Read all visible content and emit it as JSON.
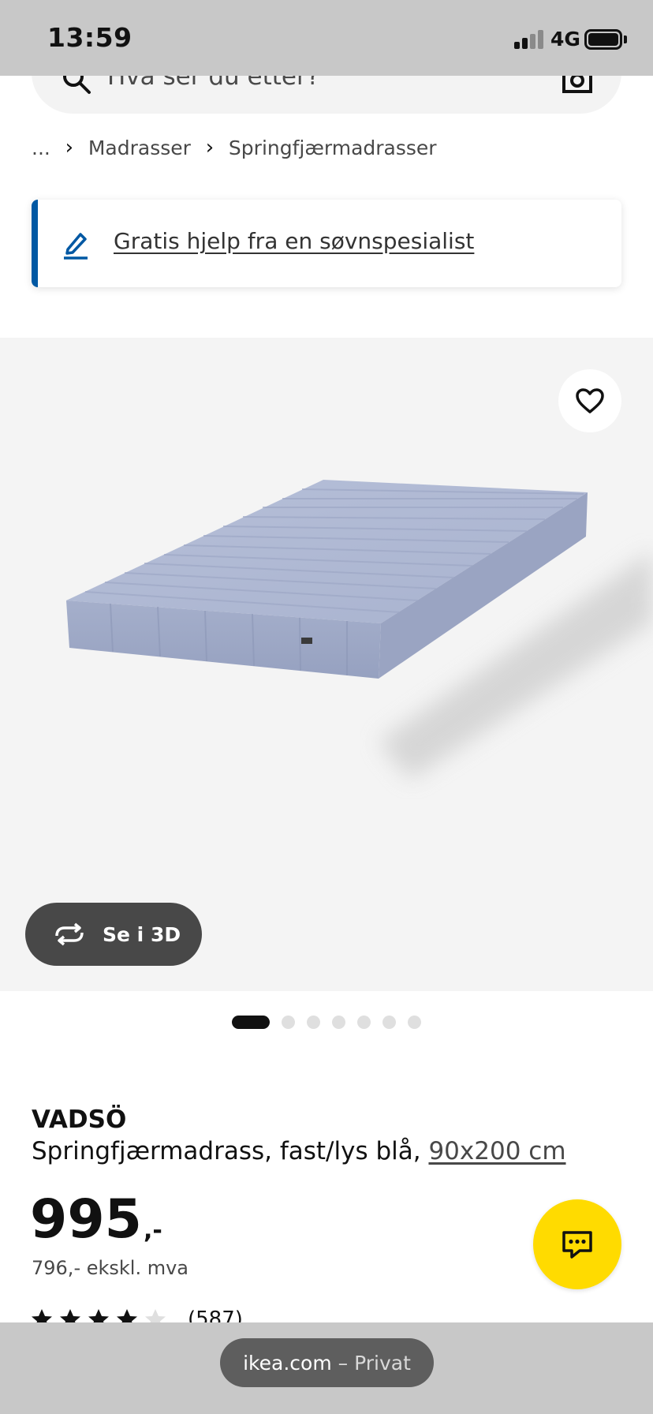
{
  "status_bar": {
    "time": "13:59",
    "network": "4G"
  },
  "search": {
    "placeholder": "Hva ser du etter?"
  },
  "breadcrumb": {
    "ellipsis": "...",
    "items": [
      "Madrasser",
      "Springfjærmadrasser"
    ]
  },
  "help_banner": {
    "text": "Gratis hjelp fra en søvnspesialist",
    "accent_color": "#0058a3"
  },
  "product_image": {
    "view_3d_label": "Se i 3D",
    "carousel": {
      "total": 7,
      "active": 1
    }
  },
  "product": {
    "name": "VADSÖ",
    "description": "Springfjærmadrass, fast/lys blå, ",
    "size": "90x200 cm",
    "price": "995",
    "price_suffix": ",-",
    "price_ex_vat": "796,- ekskl. mva",
    "rating": {
      "stars": 4,
      "max": 5,
      "count_label": "(587)"
    }
  },
  "chat": {
    "color": "#ffdb00"
  },
  "browser": {
    "host": "ikea.com",
    "mode": "– Privat"
  }
}
